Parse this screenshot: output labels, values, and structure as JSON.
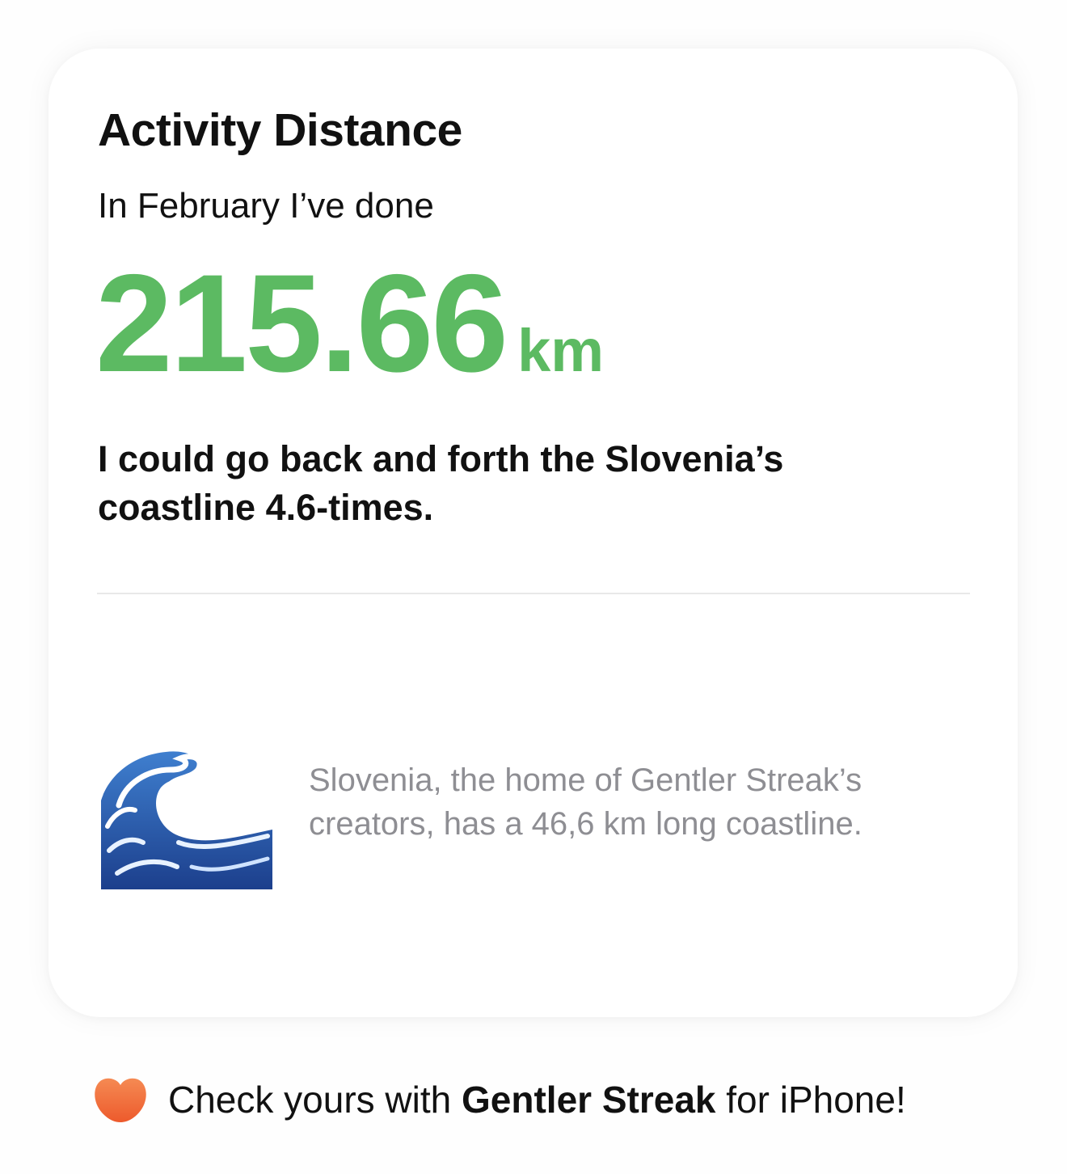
{
  "card": {
    "title": "Activity Distance",
    "intro": "In February I’ve done",
    "distance_value": "215.66",
    "distance_unit": "km",
    "comparison": "I could go back and forth the Slovenia’s coastline 4.6-times.",
    "fact_icon": "water-wave-icon",
    "fact_text": "Slovenia, the home of Gentler Streak’s creators, has a 46,6 km long coastline."
  },
  "footer": {
    "icon": "gentler-streak-logo-icon",
    "prefix": "Check yours with ",
    "brand": "Gentler Streak",
    "suffix": " for iPhone!"
  },
  "colors": {
    "accent_green": "#5cba62",
    "brand_orange": "#f2683a",
    "muted_text": "#8e8e93"
  }
}
